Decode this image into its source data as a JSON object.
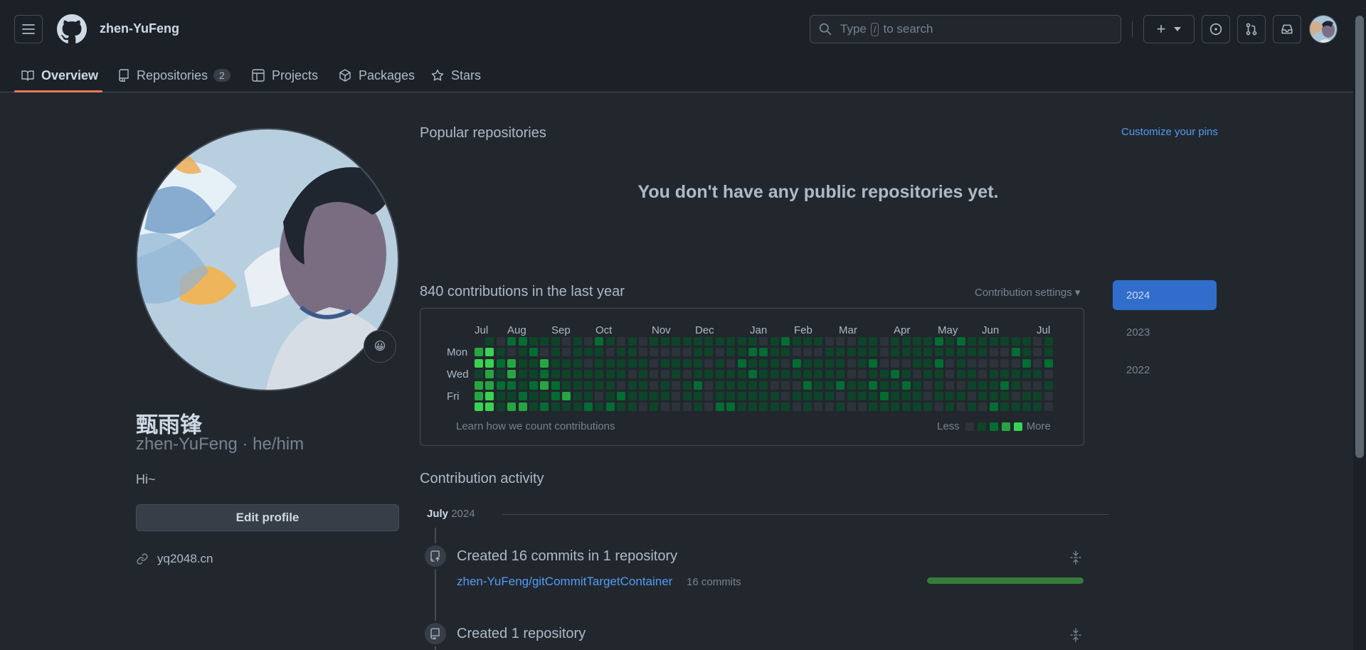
{
  "header": {
    "username": "zhen-YuFeng",
    "search_prefix": "Type",
    "search_key": "/",
    "search_suffix": "to search",
    "create_label": "+"
  },
  "tabs": [
    {
      "label": "Overview"
    },
    {
      "label": "Repositories",
      "count": "2"
    },
    {
      "label": "Projects"
    },
    {
      "label": "Packages"
    },
    {
      "label": "Stars"
    }
  ],
  "profile": {
    "full_name": "甄雨锋",
    "username_pronouns": "zhen-YuFeng · he/him",
    "bio": "Hi~",
    "edit_label": "Edit profile",
    "website": "yq2048.cn",
    "status_emoji": "😀"
  },
  "popular": {
    "title": "Popular repositories",
    "customize": "Customize your pins",
    "empty": "You don't have any public repositories yet."
  },
  "contributions": {
    "title": "840 contributions in the last year",
    "settings": "Contribution settings ▾",
    "months": [
      "Jul",
      "Aug",
      "Sep",
      "Oct",
      "Nov",
      "Dec",
      "Jan",
      "Feb",
      "Mar",
      "Apr",
      "May",
      "Jun",
      "Jul"
    ],
    "days": [
      "Mon",
      "Wed",
      "Fri"
    ],
    "learn": "Learn how we count contributions",
    "less": "Less",
    "more": "More",
    "colors": [
      "#2d333b",
      "#0e4429",
      "#006d32",
      "#26a641",
      "#39d353"
    ]
  },
  "years": [
    "2024",
    "2023",
    "2022"
  ],
  "activity": {
    "title": "Contribution activity",
    "month": "July",
    "year": "2024",
    "items": [
      {
        "title": "Created 16 commits in 1 repository",
        "repo": "zhen-YuFeng/gitCommitTargetContainer",
        "commits": "16 commits",
        "progress": 1.0
      },
      {
        "title": "Created 1 repository"
      }
    ]
  }
}
